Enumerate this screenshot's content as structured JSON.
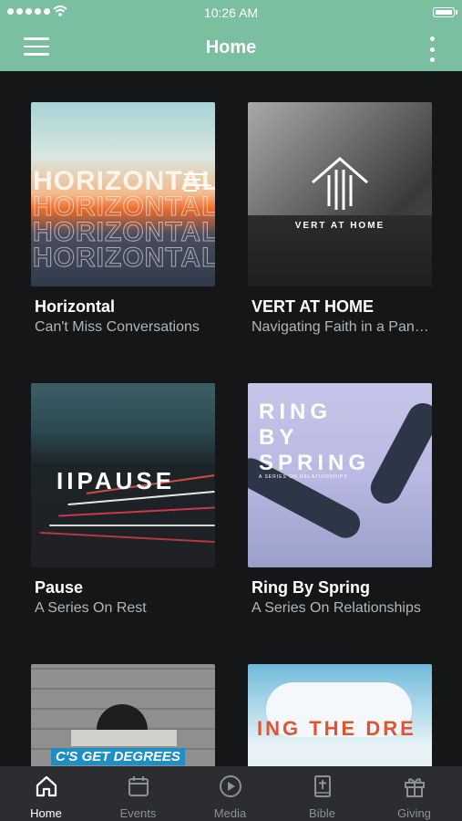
{
  "status": {
    "time": "10:26 AM"
  },
  "app_bar": {
    "title": "Home"
  },
  "series": [
    {
      "title": "Horizontal",
      "subtitle": "Can't Miss Conversations",
      "art_text": "HORIZONTAL"
    },
    {
      "title": "VERT AT HOME",
      "subtitle": "Navigating Faith in a Pandemic",
      "art_text": "VERT AT HOME"
    },
    {
      "title": "Pause",
      "subtitle": "A Series On Rest",
      "art_text": "IIPAUSE"
    },
    {
      "title": "Ring By Spring",
      "subtitle": "A Series On Relationships",
      "art_text": [
        "RING",
        "BY",
        "SPRING"
      ],
      "art_small": "A SERIES ON RELATIONSHIPS"
    },
    {
      "title": "",
      "subtitle": "",
      "art_text": "C'S GET DEGREES"
    },
    {
      "title": "",
      "subtitle": "",
      "art_text": "ING THE DRE"
    }
  ],
  "tabs": [
    {
      "label": "Home",
      "icon": "home-icon",
      "active": true
    },
    {
      "label": "Events",
      "icon": "calendar-icon",
      "active": false
    },
    {
      "label": "Media",
      "icon": "play-circle-icon",
      "active": false
    },
    {
      "label": "Bible",
      "icon": "bible-icon",
      "active": false
    },
    {
      "label": "Giving",
      "icon": "gift-icon",
      "active": false
    }
  ],
  "colors": {
    "accent": "#7bbfa1",
    "background": "#141618",
    "tabbar": "#2b2d30",
    "subtitle": "#b3b6b8"
  }
}
